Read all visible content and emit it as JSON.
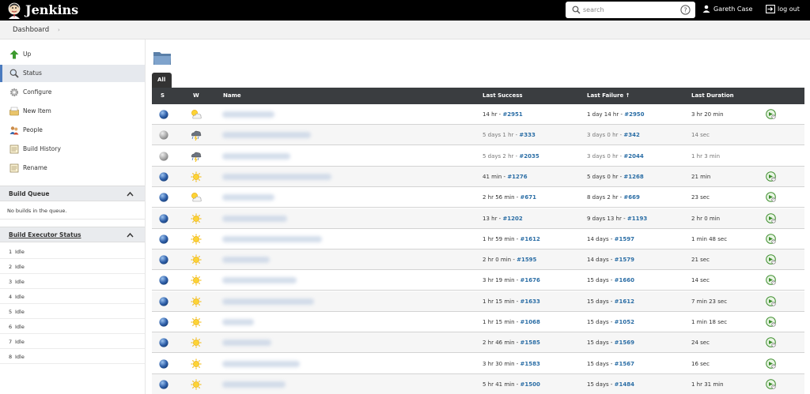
{
  "header": {
    "brand": "Jenkins",
    "search_placeholder": "search",
    "user_name": "Gareth Case",
    "logout_label": "log out"
  },
  "breadcrumb": {
    "items": [
      "Dashboard"
    ]
  },
  "sidebar": {
    "tasks": [
      {
        "label": "Up",
        "icon": "up-arrow-icon"
      },
      {
        "label": "Status",
        "icon": "magnifier-icon",
        "active": true
      },
      {
        "label": "Configure",
        "icon": "gear-icon"
      },
      {
        "label": "New Item",
        "icon": "new-item-icon"
      },
      {
        "label": "People",
        "icon": "people-icon"
      },
      {
        "label": "Build History",
        "icon": "notepad-icon"
      },
      {
        "label": "Rename",
        "icon": "notepad-icon"
      }
    ],
    "build_queue": {
      "title": "Build Queue",
      "empty_text": "No builds in the queue."
    },
    "executors": {
      "title": "Build Executor Status",
      "items": [
        {
          "num": "1",
          "status": "Idle"
        },
        {
          "num": "2",
          "status": "Idle"
        },
        {
          "num": "3",
          "status": "Idle"
        },
        {
          "num": "4",
          "status": "Idle"
        },
        {
          "num": "5",
          "status": "Idle"
        },
        {
          "num": "6",
          "status": "Idle"
        },
        {
          "num": "7",
          "status": "Idle"
        },
        {
          "num": "8",
          "status": "Idle"
        }
      ]
    }
  },
  "main": {
    "tab_label": "All",
    "columns": {
      "s": "S",
      "w": "W",
      "name": "Name",
      "last_success": "Last Success",
      "last_failure": "Last Failure ↑",
      "last_duration": "Last Duration"
    },
    "rows": [
      {
        "status": "blue",
        "weather": "partly-cloudy",
        "success": "14 hr - ",
        "success_build": "#2951",
        "failure": "1 day 14 hr - ",
        "failure_build": "#2950",
        "duration": "3 hr 20 min",
        "disabled": false
      },
      {
        "status": "grey",
        "weather": "storm",
        "success": "5 days 1 hr - ",
        "success_build": "#333",
        "failure": "3 days 0 hr - ",
        "failure_build": "#342",
        "duration": "14 sec",
        "disabled": true
      },
      {
        "status": "grey",
        "weather": "storm",
        "success": "5 days 2 hr - ",
        "success_build": "#2035",
        "failure": "3 days 0 hr - ",
        "failure_build": "#2044",
        "duration": "1 hr 3 min",
        "disabled": true
      },
      {
        "status": "blue",
        "weather": "sunny",
        "success": "41 min - ",
        "success_build": "#1276",
        "failure": "5 days 0 hr - ",
        "failure_build": "#1268",
        "duration": "21 min",
        "disabled": false
      },
      {
        "status": "blue",
        "weather": "partly-cloudy",
        "success": "2 hr 56 min - ",
        "success_build": "#671",
        "failure": "8 days 2 hr - ",
        "failure_build": "#669",
        "duration": "23 sec",
        "disabled": false
      },
      {
        "status": "blue",
        "weather": "sunny",
        "success": "13 hr - ",
        "success_build": "#1202",
        "failure": "9 days 13 hr - ",
        "failure_build": "#1193",
        "duration": "2 hr 0 min",
        "disabled": false
      },
      {
        "status": "blue",
        "weather": "sunny",
        "success": "1 hr 59 min - ",
        "success_build": "#1612",
        "failure": "14 days - ",
        "failure_build": "#1597",
        "duration": "1 min 48 sec",
        "disabled": false
      },
      {
        "status": "blue",
        "weather": "sunny",
        "success": "2 hr 0 min - ",
        "success_build": "#1595",
        "failure": "14 days - ",
        "failure_build": "#1579",
        "duration": "21 sec",
        "disabled": false
      },
      {
        "status": "blue",
        "weather": "sunny",
        "success": "3 hr 19 min - ",
        "success_build": "#1676",
        "failure": "15 days - ",
        "failure_build": "#1660",
        "duration": "14 sec",
        "disabled": false
      },
      {
        "status": "blue",
        "weather": "sunny",
        "success": "1 hr 15 min - ",
        "success_build": "#1633",
        "failure": "15 days - ",
        "failure_build": "#1612",
        "duration": "7 min 23 sec",
        "disabled": false
      },
      {
        "status": "blue",
        "weather": "sunny",
        "success": "1 hr 15 min - ",
        "success_build": "#1068",
        "failure": "15 days - ",
        "failure_build": "#1052",
        "duration": "1 min 18 sec",
        "disabled": false
      },
      {
        "status": "blue",
        "weather": "sunny",
        "success": "2 hr 46 min - ",
        "success_build": "#1585",
        "failure": "15 days - ",
        "failure_build": "#1569",
        "duration": "24 sec",
        "disabled": false
      },
      {
        "status": "blue",
        "weather": "sunny",
        "success": "3 hr 30 min - ",
        "success_build": "#1583",
        "failure": "15 days - ",
        "failure_build": "#1567",
        "duration": "16 sec",
        "disabled": false
      },
      {
        "status": "blue",
        "weather": "sunny",
        "success": "5 hr 41 min - ",
        "success_build": "#1500",
        "failure": "15 days - ",
        "failure_build": "#1484",
        "duration": "1 hr 31 min",
        "disabled": false
      }
    ]
  }
}
